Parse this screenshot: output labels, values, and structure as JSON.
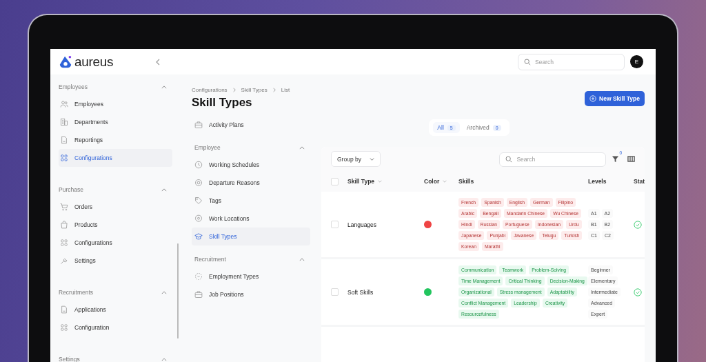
{
  "header": {
    "logo": "aureus",
    "search_placeholder": "Search",
    "avatar": "E"
  },
  "sidebar": {
    "groups": [
      {
        "title": "Employees",
        "expanded": true,
        "items": [
          {
            "label": "Employees",
            "selected": false
          },
          {
            "label": "Departments",
            "selected": false
          },
          {
            "label": "Reportings",
            "selected": false
          },
          {
            "label": "Configurations",
            "selected": true
          }
        ]
      },
      {
        "title": "Purchase",
        "expanded": true,
        "items": [
          {
            "label": "Orders",
            "selected": false
          },
          {
            "label": "Products",
            "selected": false
          },
          {
            "label": "Configurations",
            "selected": false
          },
          {
            "label": "Settings",
            "selected": false
          }
        ]
      },
      {
        "title": "Recruitments",
        "expanded": true,
        "items": [
          {
            "label": "Applications",
            "selected": false
          },
          {
            "label": "Configuration",
            "selected": false
          }
        ]
      },
      {
        "title": "Settings",
        "expanded": true
      }
    ]
  },
  "breadcrumb": [
    "Configurations",
    "Skill Types",
    "List"
  ],
  "page_title": "Skill Types",
  "new_button": "New Skill Type",
  "subnav": {
    "top_items": [
      {
        "label": "Activity Plans",
        "selected": false
      }
    ],
    "groups": [
      {
        "title": "Employee",
        "expanded": true,
        "items": [
          {
            "label": "Working Schedules",
            "selected": false
          },
          {
            "label": "Departure Reasons",
            "selected": false
          },
          {
            "label": "Tags",
            "selected": false
          },
          {
            "label": "Work Locations",
            "selected": false
          },
          {
            "label": "Skill Types",
            "selected": true
          }
        ]
      },
      {
        "title": "Recruitment",
        "expanded": true,
        "items": [
          {
            "label": "Employment Types",
            "selected": false
          },
          {
            "label": "Job Positions",
            "selected": false
          }
        ]
      }
    ]
  },
  "filter_tabs": [
    {
      "label": "All",
      "count": "5",
      "selected": true
    },
    {
      "label": "Archived",
      "count": "0",
      "selected": false
    }
  ],
  "toolbar": {
    "group_by": "Group by",
    "search_placeholder": "Search",
    "filter_count": "0"
  },
  "table": {
    "select_all_checked": false,
    "columns": [
      "Skill Type",
      "Color",
      "Skills",
      "Levels",
      "Stat"
    ],
    "rows": [
      {
        "name": "Languages",
        "color": "#ef4444",
        "checked": false,
        "active": true,
        "skills": [
          "French",
          "Spanish",
          "English",
          "German",
          "Filipino",
          "Arabic",
          "Bengali",
          "Mandarin Chinese",
          "Wu Chinese",
          "Hindi",
          "Russian",
          "Portuguese",
          "Indonesian",
          "Urdu",
          "Japanese",
          "Punjabi",
          "Javanese",
          "Telugu",
          "Turkish",
          "Korean",
          "Marathi"
        ],
        "levels": [
          "A1",
          "A2",
          "B1",
          "B2",
          "C1",
          "C2"
        ]
      },
      {
        "name": "Soft Skills",
        "color": "#22c55e",
        "checked": false,
        "active": true,
        "skills": [
          "Communication",
          "Teamwork",
          "Problem-Solving",
          "Time Management",
          "Critical Thinking",
          "Decision-Making",
          "Organizational",
          "Stress management",
          "Adaptability",
          "Conflict Management",
          "Leadership",
          "Creativity",
          "Resourcefulness"
        ],
        "levels": [
          "Beginner",
          "Elementary",
          "Intermediate",
          "Advanced",
          "Expert"
        ]
      }
    ]
  }
}
